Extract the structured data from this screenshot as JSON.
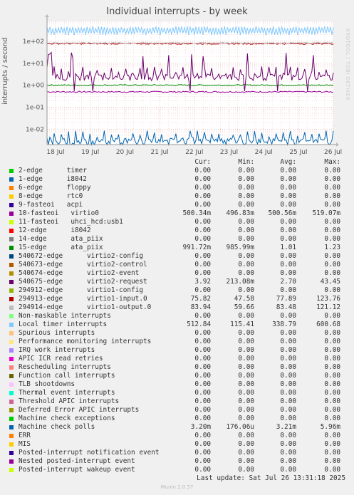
{
  "title": "Individual interrupts - by week",
  "side_label": "RRDTOOL / TOBI OETIKER",
  "footer": "Last update: Sat Jul 26 13:31:18 2025",
  "generator": "Munin 2.0.57",
  "legend_header": [
    "Cur:",
    "Min:",
    "Avg:",
    "Max:"
  ],
  "chart_data": {
    "type": "line",
    "title": "Individual interrupts - by week",
    "ylabel": "interrupts / second",
    "yscale": "log",
    "ylim": [
      0.002,
      800
    ],
    "ytick_labels": [
      "1e-02",
      "1e-01",
      "1e+00",
      "1e+01",
      "1e+02"
    ],
    "ytick_values": [
      0.01,
      0.1,
      1,
      10,
      100
    ],
    "xtick_labels": [
      "18 Jul",
      "19 Jul",
      "20 Jul",
      "21 Jul",
      "22 Jul",
      "23 Jul",
      "24 Jul",
      "25 Jul",
      "26 Jul"
    ],
    "grid": true,
    "series": [
      {
        "name": "2-edge      timer",
        "color": "#00cc00",
        "cur": "0.00",
        "min": "0.00",
        "avg": "0.00",
        "max": "0.00"
      },
      {
        "name": "1-edge      i8042",
        "color": "#0066b3",
        "cur": "0.00",
        "min": "0.00",
        "avg": "0.00",
        "max": "0.00"
      },
      {
        "name": "6-edge      floppy",
        "color": "#ff8000",
        "cur": "0.00",
        "min": "0.00",
        "avg": "0.00",
        "max": "0.00"
      },
      {
        "name": "8-edge      rtc0",
        "color": "#ffcc00",
        "cur": "0.00",
        "min": "0.00",
        "avg": "0.00",
        "max": "0.00"
      },
      {
        "name": "9-fasteoi   acpi",
        "color": "#330099",
        "cur": "0.00",
        "min": "0.00",
        "avg": "0.00",
        "max": "0.00"
      },
      {
        "name": "10-fasteoi   virtio0",
        "color": "#990099",
        "cur": "500.34m",
        "min": "496.83m",
        "avg": "500.56m",
        "max": "519.07m"
      },
      {
        "name": "11-fasteoi   uhci_hcd:usb1",
        "color": "#ccff00",
        "cur": "0.00",
        "min": "0.00",
        "avg": "0.00",
        "max": "0.00"
      },
      {
        "name": "12-edge      i8042",
        "color": "#ff0000",
        "cur": "0.00",
        "min": "0.00",
        "avg": "0.00",
        "max": "0.00"
      },
      {
        "name": "14-edge      ata_piix",
        "color": "#808080",
        "cur": "0.00",
        "min": "0.00",
        "avg": "0.00",
        "max": "0.00"
      },
      {
        "name": "15-edge      ata_piix",
        "color": "#008f00",
        "cur": "991.72m",
        "min": "985.99m",
        "avg": "1.01",
        "max": "1.23"
      },
      {
        "name": "540672-edge      virtio2-config",
        "color": "#00487d",
        "cur": "0.00",
        "min": "0.00",
        "avg": "0.00",
        "max": "0.00"
      },
      {
        "name": "540673-edge      virtio2-control",
        "color": "#b35a00",
        "cur": "0.00",
        "min": "0.00",
        "avg": "0.00",
        "max": "0.00"
      },
      {
        "name": "540674-edge      virtio2-event",
        "color": "#b38f00",
        "cur": "0.00",
        "min": "0.00",
        "avg": "0.00",
        "max": "0.00"
      },
      {
        "name": "540675-edge      virtio2-request",
        "color": "#6b006b",
        "cur": "3.92",
        "min": "213.08m",
        "avg": "2.70",
        "max": "43.45"
      },
      {
        "name": "294912-edge      virtio1-config",
        "color": "#8fb300",
        "cur": "0.00",
        "min": "0.00",
        "avg": "0.00",
        "max": "0.00"
      },
      {
        "name": "294913-edge      virtio1-input.0",
        "color": "#b30000",
        "cur": "75.82",
        "min": "47.58",
        "avg": "77.89",
        "max": "123.76"
      },
      {
        "name": "294914-edge      virtio1-output.0",
        "color": "#bebebe",
        "cur": "83.94",
        "min": "59.66",
        "avg": "83.48",
        "max": "121.12"
      },
      {
        "name": "Non-maskable interrupts",
        "color": "#80ff80",
        "cur": "0.00",
        "min": "0.00",
        "avg": "0.00",
        "max": "0.00"
      },
      {
        "name": "Local timer interrupts",
        "color": "#80c9ff",
        "cur": "512.84",
        "min": "115.41",
        "avg": "338.79",
        "max": "600.68"
      },
      {
        "name": "Spurious interrupts",
        "color": "#ffc080",
        "cur": "0.00",
        "min": "0.00",
        "avg": "0.00",
        "max": "0.00"
      },
      {
        "name": "Performance monitoring interrupts",
        "color": "#ffe680",
        "cur": "0.00",
        "min": "0.00",
        "avg": "0.00",
        "max": "0.00"
      },
      {
        "name": "IRQ work interrupts",
        "color": "#aa80ff",
        "cur": "0.00",
        "min": "0.00",
        "avg": "0.00",
        "max": "0.00"
      },
      {
        "name": "APIC ICR read retries",
        "color": "#ee00cc",
        "cur": "0.00",
        "min": "0.00",
        "avg": "0.00",
        "max": "0.00"
      },
      {
        "name": "Rescheduling interrupts",
        "color": "#ff8080",
        "cur": "0.00",
        "min": "0.00",
        "avg": "0.00",
        "max": "0.00"
      },
      {
        "name": "Function call interrupts",
        "color": "#666600",
        "cur": "0.00",
        "min": "0.00",
        "avg": "0.00",
        "max": "0.00"
      },
      {
        "name": "TLB shootdowns",
        "color": "#ffbfff",
        "cur": "0.00",
        "min": "0.00",
        "avg": "0.00",
        "max": "0.00"
      },
      {
        "name": "Thermal event interrupts",
        "color": "#00ffcc",
        "cur": "0.00",
        "min": "0.00",
        "avg": "0.00",
        "max": "0.00"
      },
      {
        "name": "Threshold APIC interrupts",
        "color": "#cc6699",
        "cur": "0.00",
        "min": "0.00",
        "avg": "0.00",
        "max": "0.00"
      },
      {
        "name": "Deferred Error APIC interrupts",
        "color": "#999900",
        "cur": "0.00",
        "min": "0.00",
        "avg": "0.00",
        "max": "0.00"
      },
      {
        "name": "Machine check exceptions",
        "color": "#00cc00",
        "cur": "0.00",
        "min": "0.00",
        "avg": "0.00",
        "max": "0.00"
      },
      {
        "name": "Machine check polls",
        "color": "#0066b3",
        "cur": "3.20m",
        "min": "176.06u",
        "avg": "3.21m",
        "max": "5.96m"
      },
      {
        "name": "ERR",
        "color": "#ff8000",
        "cur": "0.00",
        "min": "0.00",
        "avg": "0.00",
        "max": "0.00"
      },
      {
        "name": "MIS",
        "color": "#ffcc00",
        "cur": "0.00",
        "min": "0.00",
        "avg": "0.00",
        "max": "0.00"
      },
      {
        "name": "Posted-interrupt notification event",
        "color": "#330099",
        "cur": "0.00",
        "min": "0.00",
        "avg": "0.00",
        "max": "0.00"
      },
      {
        "name": "Nested posted-interrupt event",
        "color": "#990099",
        "cur": "0.00",
        "min": "0.00",
        "avg": "0.00",
        "max": "0.00"
      },
      {
        "name": "Posted-interrupt wakeup event",
        "color": "#ccff00",
        "cur": "0.00",
        "min": "0.00",
        "avg": "0.00",
        "max": "0.00"
      }
    ]
  }
}
